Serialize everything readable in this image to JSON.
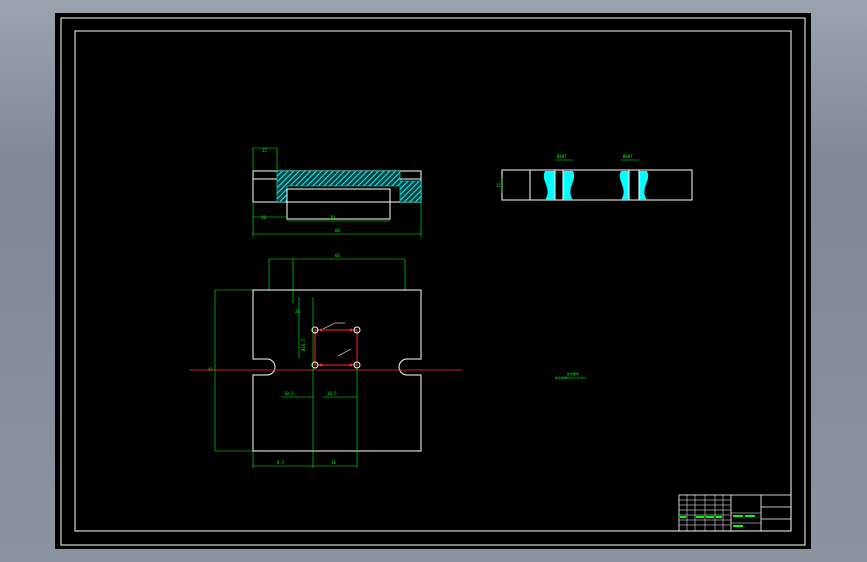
{
  "drawing": {
    "colors": {
      "background": "#000000",
      "frame": "#ffffff",
      "dimension": "#00ff00",
      "hatch": "#00ffff",
      "centerline": "#ff0000",
      "holes": "#ff3333"
    },
    "top_view": {
      "width_label": "50",
      "height_label": "15",
      "inner_label": "30",
      "overall_label": "60"
    },
    "side_view": {
      "thickness_label": "15",
      "hole_label_1": "Ø4H7",
      "hole_label_2": "Ø4H7"
    },
    "plan_view": {
      "top_width_label": "60",
      "left_height_label": "45",
      "hole_offset_label_1": "20",
      "hole_offset_label_2": "Ø16.5",
      "hole_spacing_x_label": "10.5",
      "hole_spacing_x2_label": "18.5",
      "bottom_label_1": "8.5",
      "bottom_label_2": "18"
    },
    "note": {
      "title": "技术要求",
      "line": "未注倒角均为 0.5×45°"
    },
    "title_block": {
      "cells": [
        "",
        "",
        "",
        "",
        ""
      ]
    }
  }
}
